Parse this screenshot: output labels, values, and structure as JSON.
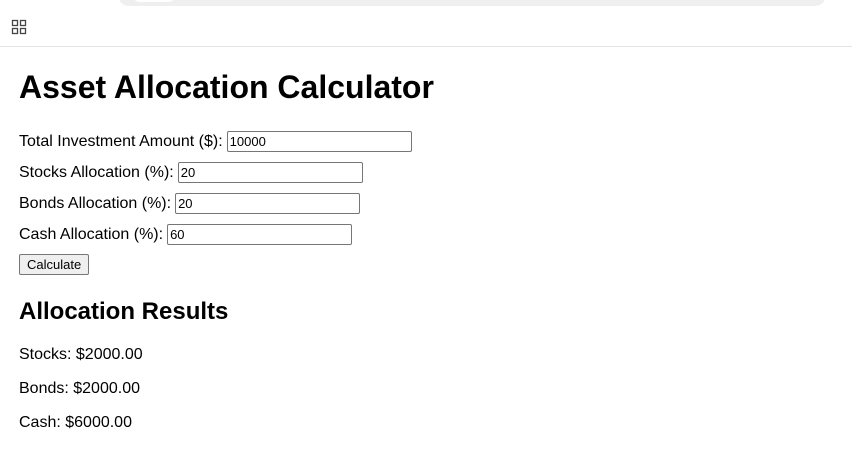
{
  "page": {
    "title": "Asset Allocation Calculator"
  },
  "form": {
    "total": {
      "label": "Total Investment Amount ($):",
      "value": "10000"
    },
    "stocks": {
      "label": "Stocks Allocation (%):",
      "value": "20"
    },
    "bonds": {
      "label": "Bonds Allocation (%):",
      "value": "20"
    },
    "cash": {
      "label": "Cash Allocation (%):",
      "value": "60"
    },
    "calculate_label": "Calculate"
  },
  "results": {
    "heading": "Allocation Results",
    "stocks": "Stocks: $2000.00",
    "bonds": "Bonds: $2000.00",
    "cash": "Cash: $6000.00"
  },
  "icons": {
    "apps": "apps-grid-icon"
  }
}
